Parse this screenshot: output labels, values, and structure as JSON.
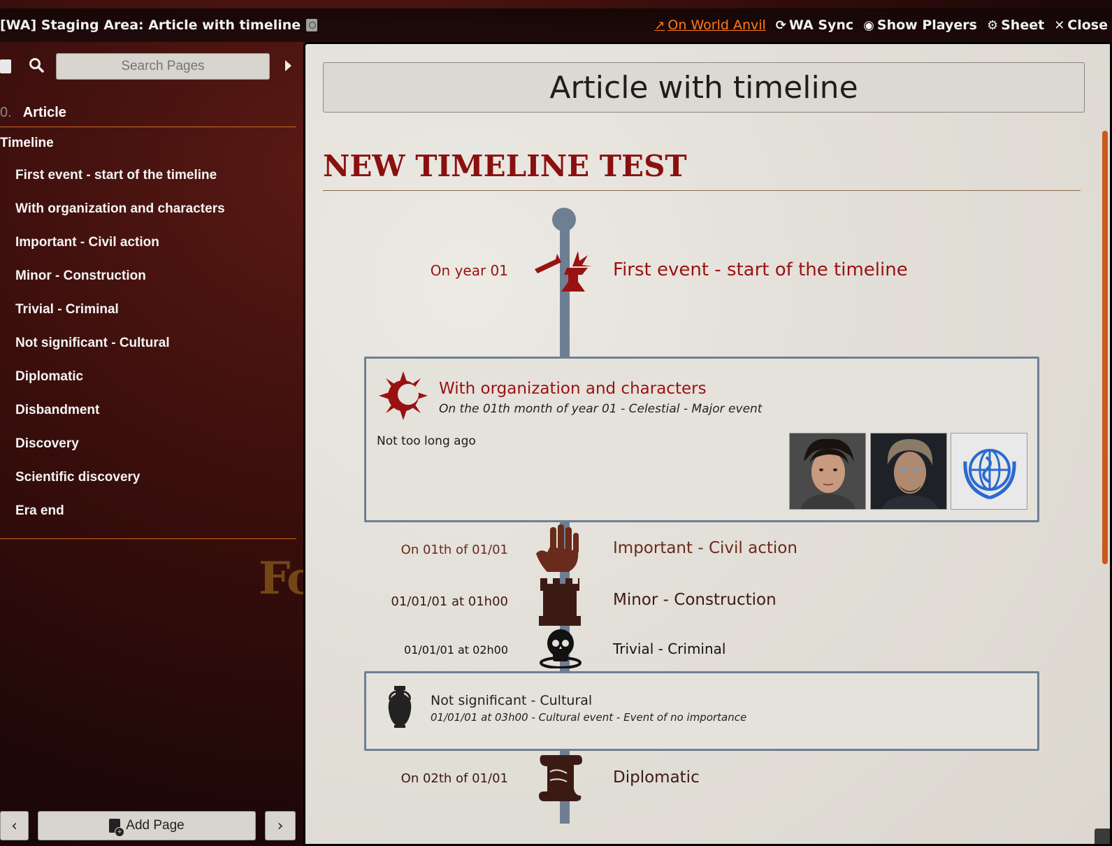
{
  "window": {
    "title": "[WA] Staging Area: Article with timeline",
    "actions": {
      "world_anvil": "On World Anvil",
      "wa_sync": "WA Sync",
      "show_players": "Show Players",
      "sheet": "Sheet",
      "close": "Close"
    }
  },
  "sidebar": {
    "search_placeholder": "Search Pages",
    "toc_header": {
      "number": "0.",
      "label": "Article"
    },
    "group_label": "Timeline",
    "items": [
      {
        "label": "First event - start of the timeline"
      },
      {
        "label": "With organization and characters"
      },
      {
        "label": "Important - Civil action"
      },
      {
        "label": "Minor - Construction"
      },
      {
        "label": "Trivial - Criminal"
      },
      {
        "label": "Not significant - Cultural"
      },
      {
        "label": "Diplomatic"
      },
      {
        "label": "Disbandment"
      },
      {
        "label": "Discovery"
      },
      {
        "label": "Scientific discovery"
      },
      {
        "label": "Era end"
      }
    ],
    "background_text": "Fo",
    "add_page_label": "Add Page"
  },
  "article": {
    "title": "Article with timeline",
    "section_heading": "NEW TIMELINE TEST",
    "events": [
      {
        "date": "On year 01",
        "title": "First event - start of the timeline",
        "icon": "anvil-icon",
        "color": "#9a1111"
      },
      {
        "title": "With organization and characters",
        "subtitle": "On the 01th month of year 01 - Celestial - Major event",
        "body": "Not too long ago",
        "icon": "sun-moon-icon",
        "color": "#9a1111",
        "thumbnails": [
          "character-portrait-1",
          "character-portrait-2",
          "organization-emblem"
        ]
      },
      {
        "date": "On 01th of 01/01",
        "title": "Important - Civil action",
        "icon": "raised-hand-icon",
        "color": "#6a2a1c"
      },
      {
        "date": "01/01/01 at 01h00",
        "title": "Minor - Construction",
        "icon": "tower-icon",
        "color": "#3c1a14"
      },
      {
        "date": "01/01/01 at 02h00",
        "title": "Trivial - Criminal",
        "icon": "skull-icon",
        "color": "#111111"
      },
      {
        "title": "Not significant - Cultural",
        "subtitle": "01/01/01 at 03h00 - Cultural event - Event of no importance",
        "icon": "vase-icon",
        "color": "#222222"
      },
      {
        "date": "On 02th of 01/01",
        "title": "Diplomatic",
        "icon": "scroll-icon",
        "color": "#3c1a14"
      }
    ]
  },
  "colors": {
    "accent_orange": "#ff7a1a",
    "heading_red": "#8a1010",
    "timeline_blue": "#6f7f93"
  }
}
